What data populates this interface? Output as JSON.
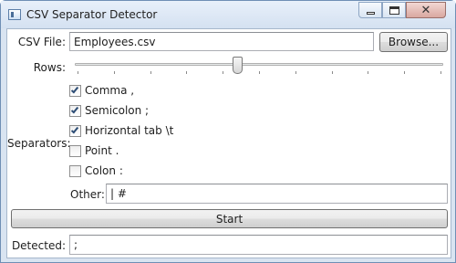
{
  "window": {
    "title": "CSV Separator Detector",
    "min_icon": "minimize-icon",
    "max_icon": "maximize-icon",
    "close_icon": "close-icon"
  },
  "csv_file": {
    "label": "CSV File:",
    "value": "Employees.csv",
    "browse_label": "Browse..."
  },
  "rows": {
    "label": "Rows:",
    "slider_fraction": 0.44
  },
  "separators": {
    "label": "Separators:",
    "items": [
      {
        "label": "Comma ,",
        "checked": true
      },
      {
        "label": "Semicolon ;",
        "checked": true
      },
      {
        "label": "Horizontal tab \\t",
        "checked": true
      },
      {
        "label": "Point .",
        "checked": false
      },
      {
        "label": "Colon :",
        "checked": false
      }
    ],
    "other_label": "Other:",
    "other_value": "| #"
  },
  "start_label": "Start",
  "detected": {
    "label": "Detected:",
    "value": ";"
  }
}
